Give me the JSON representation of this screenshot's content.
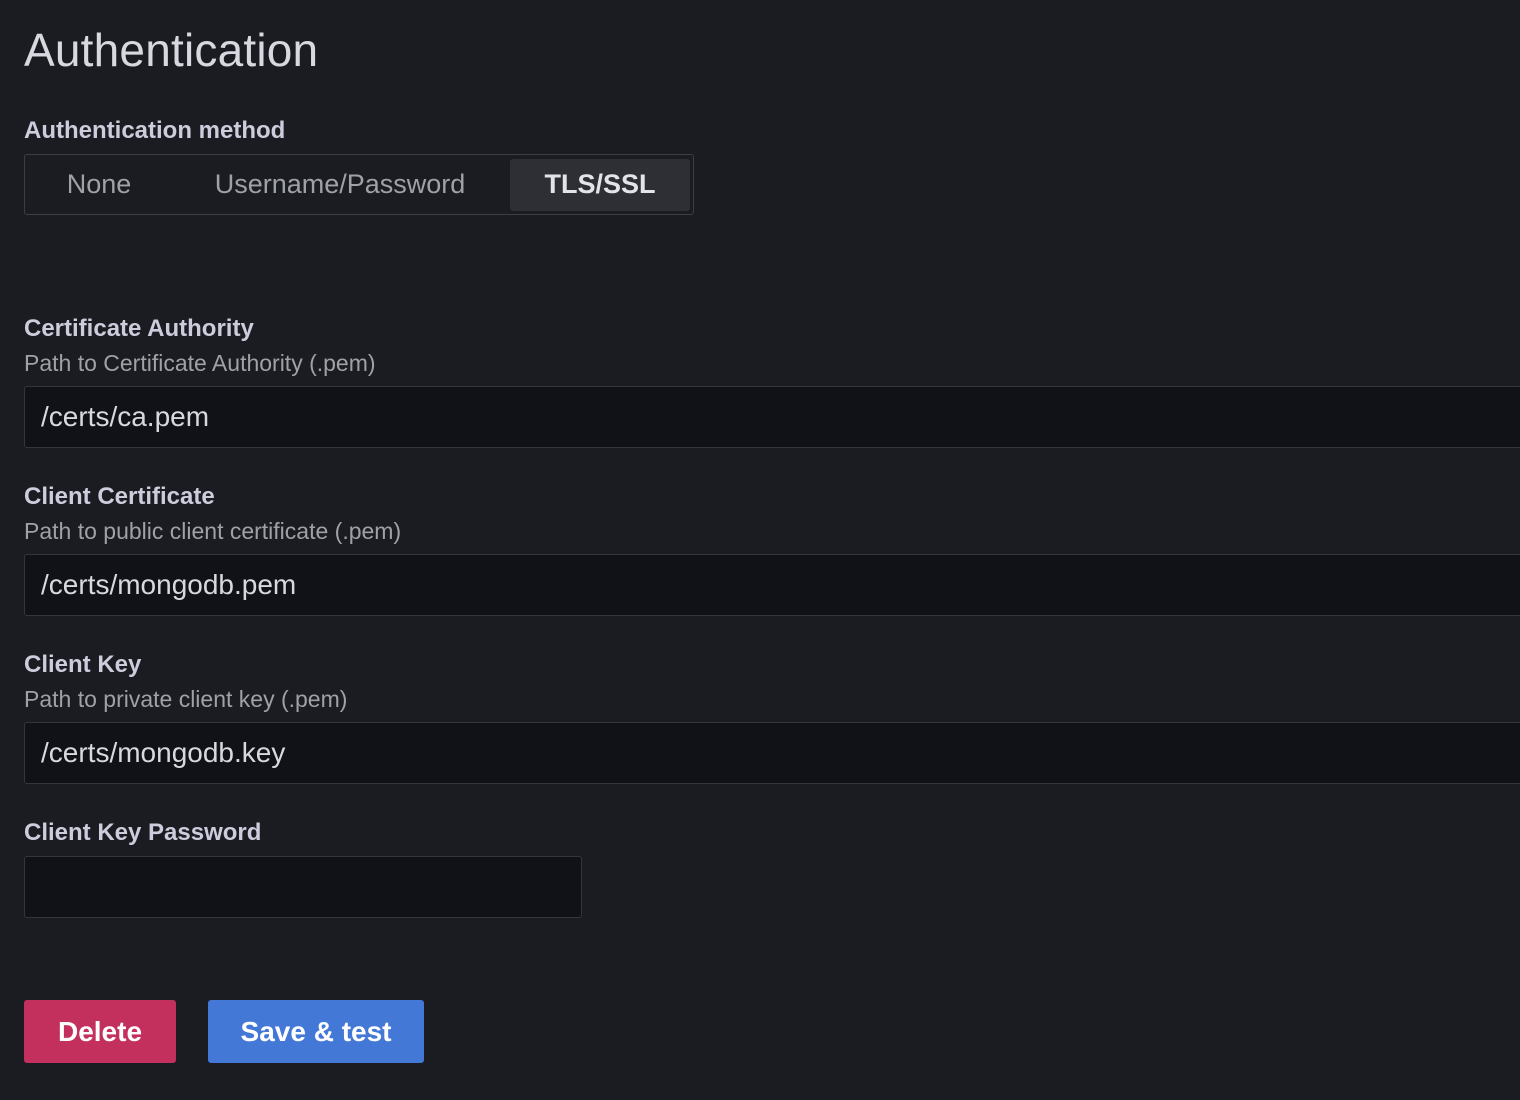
{
  "section": {
    "title": "Authentication"
  },
  "auth_method": {
    "label": "Authentication method",
    "options": [
      {
        "label": "None",
        "selected": false
      },
      {
        "label": "Username/Password",
        "selected": false
      },
      {
        "label": "TLS/SSL",
        "selected": true
      }
    ]
  },
  "fields": {
    "ca": {
      "label": "Certificate Authority",
      "description": "Path to Certificate Authority (.pem)",
      "value": "/certs/ca.pem"
    },
    "client_cert": {
      "label": "Client Certificate",
      "description": "Path to public client certificate (.pem)",
      "value": "/certs/mongodb.pem"
    },
    "client_key": {
      "label": "Client Key",
      "description": "Path to private client key (.pem)",
      "value": "/certs/mongodb.key"
    },
    "client_key_password": {
      "label": "Client Key Password",
      "value": ""
    }
  },
  "actions": {
    "delete_label": "Delete",
    "save_label": "Save & test"
  },
  "colors": {
    "background": "#1a1c21",
    "input_background": "#111217",
    "delete_button": "#c4305e",
    "save_button": "#4478d6"
  }
}
